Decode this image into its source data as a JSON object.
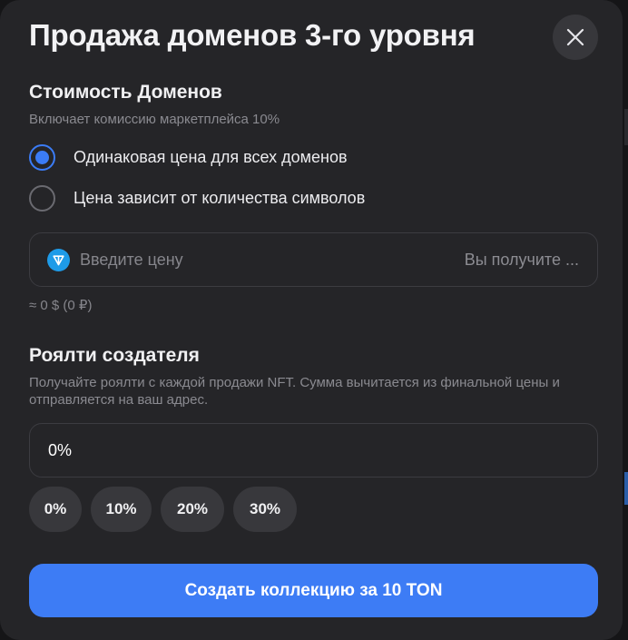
{
  "modal": {
    "title": "Продажа доменов 3-го уровня"
  },
  "pricing": {
    "section_title": "Стоимость Доменов",
    "subtitle": "Включает комиссию маркетплейса 10%",
    "options": [
      {
        "label": "Одинаковая цена для всех доменов",
        "selected": true
      },
      {
        "label": "Цена зависит от количества символов",
        "selected": false
      }
    ],
    "price_input": {
      "placeholder": "Введите цену",
      "value": "",
      "currency_icon": "ton-icon",
      "receive_hint": "Вы получите ..."
    },
    "approx_value": "≈ 0 $ (0 ₽)"
  },
  "royalty": {
    "section_title": "Роялти создателя",
    "description": "Получайте роялти с каждой продажи NFT. Сумма вычитается из финальной цены и отправляется на ваш адрес.",
    "input_value": "0%",
    "presets": [
      "0%",
      "10%",
      "20%",
      "30%"
    ]
  },
  "actions": {
    "create_label": "Создать коллекцию за 10 TON"
  },
  "colors": {
    "accent": "#3d7cf5",
    "background": "#252528",
    "ton": "#1e9be8"
  }
}
